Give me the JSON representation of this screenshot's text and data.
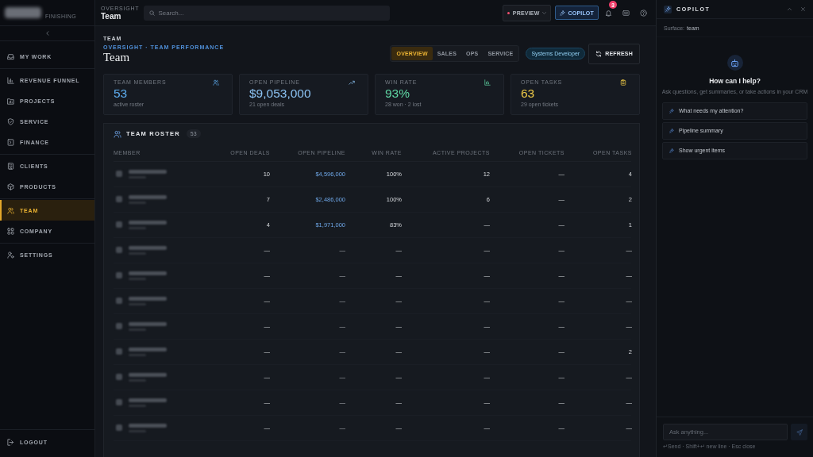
{
  "sidebar": {
    "brand_tagline": "FINISHING",
    "sections": [
      {
        "items": [
          {
            "label": "MY WORK",
            "selected": false
          }
        ]
      },
      {
        "items": [
          {
            "label": "REVENUE FUNNEL",
            "selected": false
          },
          {
            "label": "PROJECTS",
            "selected": false
          },
          {
            "label": "SERVICE",
            "selected": false
          },
          {
            "label": "FINANCE",
            "selected": false
          }
        ]
      },
      {
        "items": [
          {
            "label": "CLIENTS",
            "selected": false
          },
          {
            "label": "PRODUCTS",
            "selected": false
          }
        ]
      },
      {
        "items": [
          {
            "label": "TEAM",
            "selected": true
          },
          {
            "label": "COMPANY",
            "selected": false
          }
        ]
      },
      {
        "items": [
          {
            "label": "SETTINGS",
            "selected": false
          }
        ]
      }
    ],
    "logout": "LOGOUT"
  },
  "top_bar": {
    "section_label": "OVERSIGHT",
    "title": "Team",
    "search": {
      "placeholder": "Search..."
    },
    "preview_button": "PREVIEW",
    "copilot_button": {
      "label": "COPILOT",
      "selected": true
    },
    "notification_count": "3"
  },
  "page_header": {
    "eyebrow": "TEAM",
    "breadcrumb": "OVERSIGHT · TEAM PERFORMANCE",
    "title": "Team",
    "tabs": [
      {
        "label": "OVERVIEW",
        "selected": true
      },
      {
        "label": "SALES",
        "selected": false
      },
      {
        "label": "OPS",
        "selected": false
      },
      {
        "label": "SERVICE",
        "selected": false
      }
    ],
    "role_chip": "Systems Developer",
    "refresh_button": "REFRESH"
  },
  "stats": [
    {
      "label": "TEAM MEMBERS",
      "value": "53",
      "note": "active roster",
      "color": "#5eaef0"
    },
    {
      "label": "OPEN PIPELINE",
      "value": "$9,053,000",
      "note": "21 open deals",
      "color": "#8cc3f3"
    },
    {
      "label": "WIN RATE",
      "value": "93%",
      "note": "28 won · 2 lost",
      "color": "#5fd6a4"
    },
    {
      "label": "OPEN TASKS",
      "value": "63",
      "note": "29 open tickets",
      "color": "#f0cb48"
    }
  ],
  "roster": {
    "title": "TEAM ROSTER",
    "count": "53",
    "columns": [
      "MEMBER",
      "OPEN DEALS",
      "OPEN PIPELINE",
      "WIN RATE",
      "ACTIVE PROJECTS",
      "OPEN TICKETS",
      "OPEN TASKS"
    ],
    "rows": [
      {
        "open_deals": "10",
        "open_pipeline": "$4,596,000",
        "win_rate": "100%",
        "active_projects": "12",
        "open_tickets": "—",
        "open_tasks": "4",
        "pipeline_link": true
      },
      {
        "open_deals": "7",
        "open_pipeline": "$2,486,000",
        "win_rate": "100%",
        "active_projects": "6",
        "open_tickets": "—",
        "open_tasks": "2",
        "pipeline_link": true
      },
      {
        "open_deals": "4",
        "open_pipeline": "$1,971,000",
        "win_rate": "83%",
        "active_projects": "—",
        "open_tickets": "—",
        "open_tasks": "1",
        "pipeline_link": true
      },
      {
        "open_deals": "—",
        "open_pipeline": "—",
        "win_rate": "—",
        "active_projects": "—",
        "open_tickets": "—",
        "open_tasks": "—",
        "pipeline_link": false
      },
      {
        "open_deals": "—",
        "open_pipeline": "—",
        "win_rate": "—",
        "active_projects": "—",
        "open_tickets": "—",
        "open_tasks": "—",
        "pipeline_link": false
      },
      {
        "open_deals": "—",
        "open_pipeline": "—",
        "win_rate": "—",
        "active_projects": "—",
        "open_tickets": "—",
        "open_tasks": "—",
        "pipeline_link": false
      },
      {
        "open_deals": "—",
        "open_pipeline": "—",
        "win_rate": "—",
        "active_projects": "—",
        "open_tickets": "—",
        "open_tasks": "—",
        "pipeline_link": false
      },
      {
        "open_deals": "—",
        "open_pipeline": "—",
        "win_rate": "—",
        "active_projects": "—",
        "open_tickets": "—",
        "open_tasks": "2",
        "pipeline_link": false
      },
      {
        "open_deals": "—",
        "open_pipeline": "—",
        "win_rate": "—",
        "active_projects": "—",
        "open_tickets": "—",
        "open_tasks": "—",
        "pipeline_link": false
      },
      {
        "open_deals": "—",
        "open_pipeline": "—",
        "win_rate": "—",
        "active_projects": "—",
        "open_tickets": "—",
        "open_tasks": "—",
        "pipeline_link": false
      },
      {
        "open_deals": "—",
        "open_pipeline": "—",
        "win_rate": "—",
        "active_projects": "—",
        "open_tickets": "—",
        "open_tasks": "—",
        "pipeline_link": false
      }
    ]
  },
  "copilot": {
    "title": "COPILOT",
    "surface_label": "Surface:",
    "surface_value": "team",
    "prompt_title": "How can I help?",
    "prompt_subtitle": "Ask questions, get summaries, or take actions in your CRM",
    "suggestions": [
      "What needs my attention?",
      "Pipeline summary",
      "Show urgent items"
    ],
    "input": {
      "placeholder": "Ask anything..."
    },
    "hint": "↵Send · Shift+↵ new line · Esc close"
  }
}
